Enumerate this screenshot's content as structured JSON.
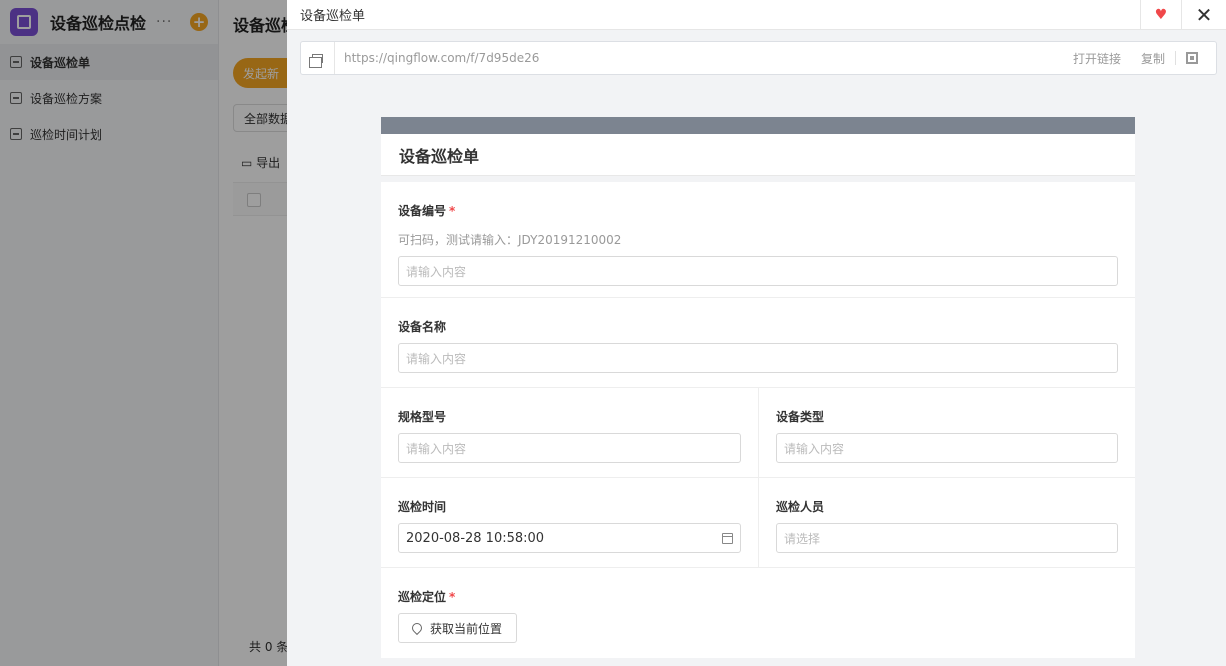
{
  "app": {
    "title": "设备巡检点检",
    "more": "···",
    "add": "+",
    "main_title": "设备巡检",
    "launch_label": "发起新",
    "filter_label": "全部数据",
    "export_label": "导出",
    "total_label": "共 0 条"
  },
  "sidebar": {
    "items": [
      {
        "label": "设备巡检单"
      },
      {
        "label": "设备巡检方案"
      },
      {
        "label": "巡检时间计划"
      }
    ]
  },
  "drawer": {
    "title": "设备巡检单",
    "close": "✕",
    "heart": "♥",
    "link": {
      "url": "https://qingflow.com/f/7d95de26",
      "open_label": "打开链接",
      "copy_label": "复制"
    }
  },
  "form": {
    "title": "设备巡检单",
    "fields": {
      "device_no": {
        "label": "设备编号",
        "required_mark": "*",
        "desc": "可扫码，测试请输入：JDY20191210002",
        "placeholder": "请输入内容"
      },
      "device_name": {
        "label": "设备名称",
        "placeholder": "请输入内容"
      },
      "spec_model": {
        "label": "规格型号",
        "placeholder": "请输入内容"
      },
      "device_type": {
        "label": "设备类型",
        "placeholder": "请输入内容"
      },
      "inspect_time": {
        "label": "巡检时间",
        "value": "2020-08-28 10:58:00"
      },
      "inspector": {
        "label": "巡检人员",
        "placeholder": "请选择"
      },
      "location": {
        "label": "巡检定位",
        "required_mark": "*",
        "button": "获取当前位置"
      }
    }
  },
  "colors": {
    "accent": "#f5a623",
    "brand_purple": "#7b4fd6",
    "required_red": "#f0484a",
    "form_topbar": "#7c8490"
  }
}
